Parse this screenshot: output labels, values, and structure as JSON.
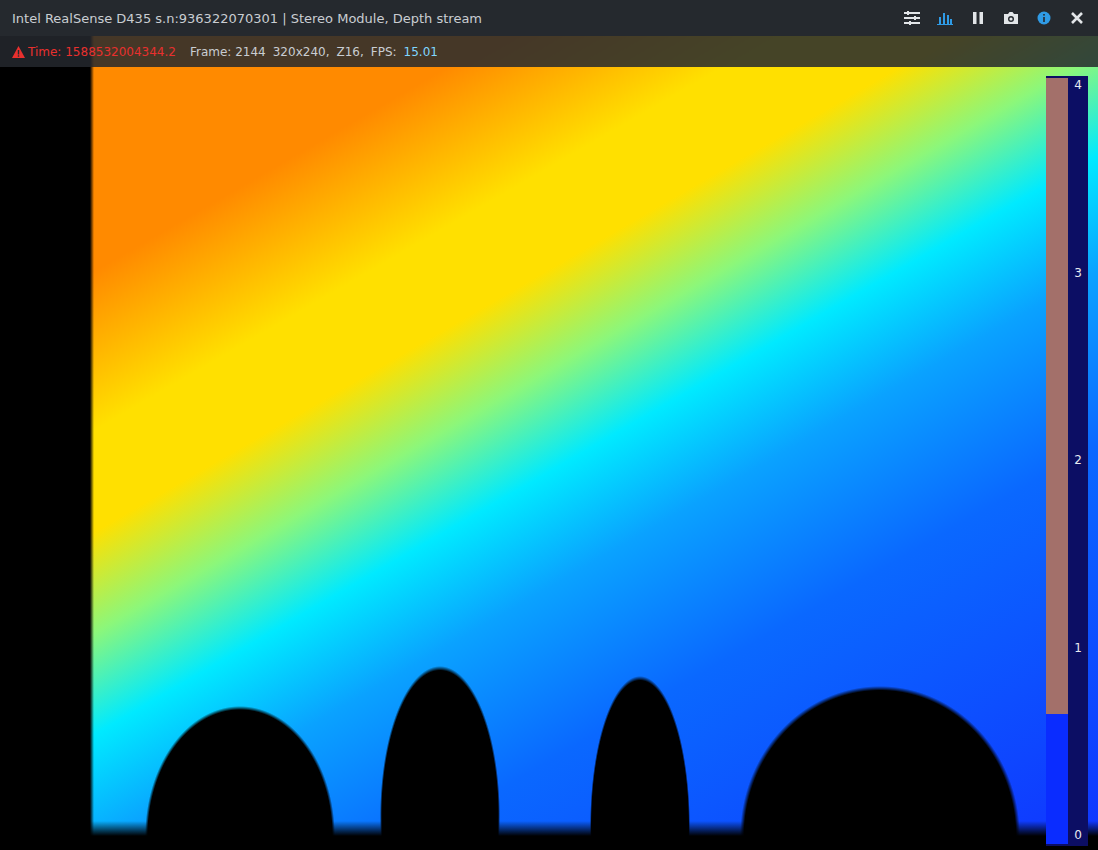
{
  "window": {
    "title": "Intel RealSense D435 s.n:936322070301 | Stereo Module, Depth stream"
  },
  "toolbar": [
    {
      "active": false
    },
    {
      "active": true
    },
    {
      "active": false
    },
    {
      "active": false
    },
    {
      "active": true
    },
    {
      "active": false
    }
  ],
  "status": {
    "warning": true,
    "time": "Time: 1588532004344.2",
    "frame": "Frame: 2144",
    "resolution": "320x240,",
    "format": "Z16,",
    "fps_label": "FPS:",
    "fps": "15.01"
  },
  "legend": {
    "ticks": [
      "4",
      "3",
      "2",
      "1",
      "0"
    ],
    "level": 0.83
  }
}
